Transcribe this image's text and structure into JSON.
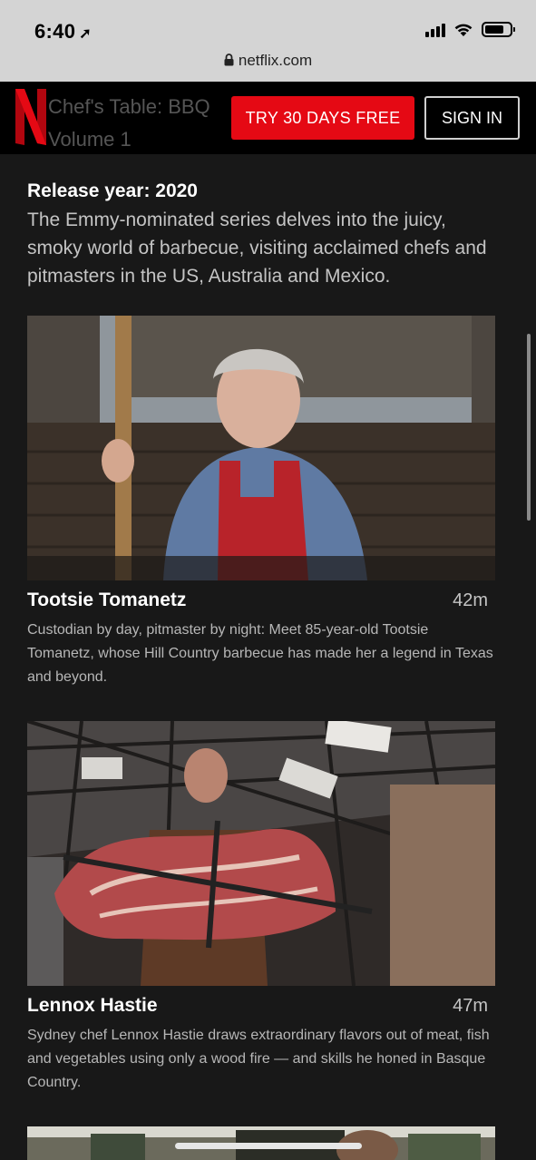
{
  "status_bar": {
    "time": "6:40",
    "location_icon": "location-arrow-icon",
    "signal_icon": "cellular-signal-icon",
    "wifi_icon": "wifi-icon",
    "battery_icon": "battery-icon",
    "battery_level": 0.75
  },
  "browser": {
    "url": "netflix.com",
    "lock_icon": "lock-icon"
  },
  "header": {
    "logo_icon": "netflix-logo-icon",
    "title_line1": "Chef's Table: BBQ",
    "title_line2": "Volume 1",
    "try_button": "TRY 30 DAYS FREE",
    "sign_in_button": "SIGN IN",
    "brand_color": "#e50914"
  },
  "show": {
    "release_label": "Release year: 2020",
    "synopsis": "The Emmy-nominated series delves into the juicy, smoky world of barbecue, visiting acclaimed chefs and pitmasters in the US, Australia and Mexico."
  },
  "episodes": [
    {
      "title": "Tootsie Tomanetz",
      "duration": "42m",
      "description": "Custodian by day, pitmaster by night: Meet 85-year-old Tootsie Tomanetz, whose Hill Country barbecue has made her a legend in Texas and beyond."
    },
    {
      "title": "Lennox Hastie",
      "duration": "47m",
      "description": "Sydney chef Lennox Hastie draws extraordinary flavors out of meat, fish and vegetables using only a wood fire — and skills he honed in Basque Country."
    }
  ]
}
